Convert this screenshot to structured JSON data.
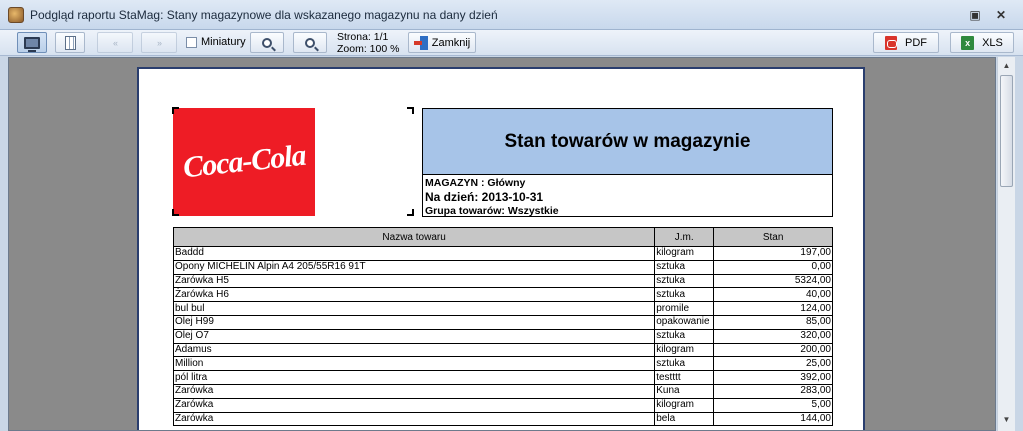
{
  "window": {
    "title": "Podgląd raportu StaMag: Stany magazynowe dla wskazanego magazynu na dany dzień",
    "restore_glyph": "▣",
    "close_glyph": "✕"
  },
  "toolbar": {
    "thumbnails_label": "Miniatury",
    "page_label": "Strona: 1/1",
    "zoom_label": "Zoom:   100 %",
    "close_label": "Zamknij",
    "pdf_label": "PDF",
    "xls_label": "XLS",
    "prev_glyph": "‹‹",
    "next_glyph": "››"
  },
  "report": {
    "logo_text": "Coca-Cola",
    "title": "Stan towarów w magazynie",
    "warehouse_line": "MAGAZYN : Główny",
    "date_line": "Na dzień:  2013-10-31",
    "group_line": "Grupa towarów: Wszystkie",
    "columns": [
      "Nazwa towaru",
      "J.m.",
      "Stan"
    ],
    "rows": [
      [
        "Baddd",
        "kilogram",
        "197,00"
      ],
      [
        "Opony MICHELIN Alpin A4 205/55R16 91T",
        "sztuka",
        "0,00"
      ],
      [
        "Żarówka H5",
        "sztuka",
        "5324,00"
      ],
      [
        "Żarówka H6",
        "sztuka",
        "40,00"
      ],
      [
        "bul bul",
        "promile",
        "124,00"
      ],
      [
        "Olej H99",
        "opakowanie",
        "85,00"
      ],
      [
        "Olej O7",
        "sztuka",
        "320,00"
      ],
      [
        "Adamus",
        "kilogram",
        "200,00"
      ],
      [
        "Million",
        "sztuka",
        "25,00"
      ],
      [
        "pól litra",
        "testttt",
        "392,00"
      ],
      [
        "Żarówka",
        "Kuna",
        "283,00"
      ],
      [
        "Żarówka",
        "kilogram",
        "5,00"
      ],
      [
        "Żarówka",
        "bela",
        "144,00"
      ]
    ]
  }
}
